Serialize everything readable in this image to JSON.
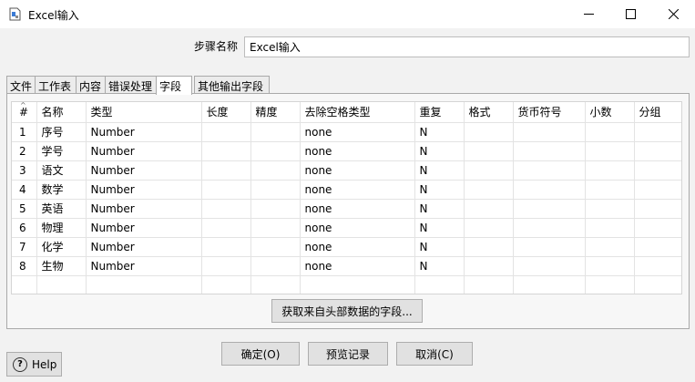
{
  "window": {
    "title": "Excel输入"
  },
  "step": {
    "label": "步骤名称",
    "value": "Excel输入"
  },
  "tabs": [
    {
      "label": "文件"
    },
    {
      "label": "工作表"
    },
    {
      "label": "内容"
    },
    {
      "label": "错误处理"
    },
    {
      "label": "字段"
    },
    {
      "label": "其他输出字段"
    }
  ],
  "active_tab": "字段",
  "table": {
    "headers": [
      "#",
      "名称",
      "类型",
      "长度",
      "精度",
      "去除空格类型",
      "重复",
      "格式",
      "货币符号",
      "小数",
      "分组"
    ],
    "rows": [
      [
        "1",
        "序号",
        "Number",
        "",
        "",
        "none",
        "N",
        "",
        "",
        "",
        ""
      ],
      [
        "2",
        "学号",
        "Number",
        "",
        "",
        "none",
        "N",
        "",
        "",
        "",
        ""
      ],
      [
        "3",
        "语文",
        "Number",
        "",
        "",
        "none",
        "N",
        "",
        "",
        "",
        ""
      ],
      [
        "4",
        "数学",
        "Number",
        "",
        "",
        "none",
        "N",
        "",
        "",
        "",
        ""
      ],
      [
        "5",
        "英语",
        "Number",
        "",
        "",
        "none",
        "N",
        "",
        "",
        "",
        ""
      ],
      [
        "6",
        "物理",
        "Number",
        "",
        "",
        "none",
        "N",
        "",
        "",
        "",
        ""
      ],
      [
        "7",
        "化学",
        "Number",
        "",
        "",
        "none",
        "N",
        "",
        "",
        "",
        ""
      ],
      [
        "8",
        "生物",
        "Number",
        "",
        "",
        "none",
        "N",
        "",
        "",
        "",
        ""
      ]
    ]
  },
  "buttons": {
    "fetch_fields": "获取来自头部数据的字段...",
    "ok": "确定(O)",
    "preview": "预览记录",
    "cancel": "取消(C)",
    "help": "Help"
  }
}
